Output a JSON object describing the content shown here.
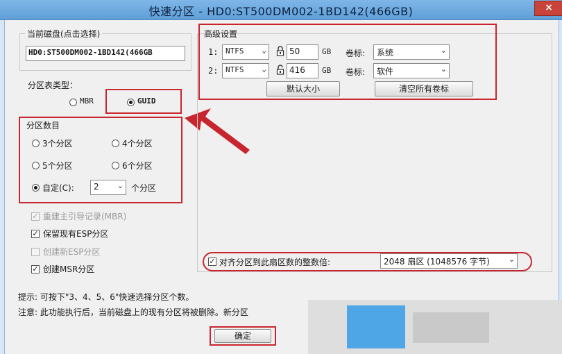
{
  "window": {
    "title": "快速分区 - HD0:ST500DM002-1BD142(466GB)",
    "close_label": "×"
  },
  "disk": {
    "section_label": "当前磁盘(点击选择)",
    "value": "HD0:ST500DM002-1BD142(466GB"
  },
  "partition_table": {
    "label": "分区表类型：",
    "options": [
      "MBR",
      "GUID"
    ],
    "selected": "GUID"
  },
  "partition_count": {
    "label": "分区数目",
    "options": [
      "3个分区",
      "4个分区",
      "5个分区",
      "6个分区"
    ],
    "custom_label": "自定(C):",
    "custom_value": "2",
    "custom_suffix": "个分区",
    "selected": "自定(C):"
  },
  "options": {
    "rebuild_mbr": "重建主引导记录(MBR)",
    "keep_esp": "保留现有ESP分区",
    "create_esp": "创建新ESP分区",
    "create_msr": "创建MSR分区"
  },
  "advanced": {
    "label": "高级设置",
    "rows": [
      {
        "index": "1:",
        "fs": "NTFS",
        "size": "50",
        "unit": "GB",
        "vol_label_caption": "卷标:",
        "vol_label": "系统"
      },
      {
        "index": "2:",
        "fs": "NTFS",
        "size": "416",
        "unit": "GB",
        "vol_label_caption": "卷标:",
        "vol_label": "软件"
      }
    ],
    "default_size_button": "默认大小",
    "clear_labels_button": "清空所有卷标"
  },
  "align": {
    "label": "对齐分区到此扇区数的整数倍:",
    "value": "2048 扇区 (1048576 字节)"
  },
  "hints": {
    "tip": "提示: 可按下\"3、4、5、6\"快速选择分区个数。",
    "note": "注意: 此功能执行后，当前磁盘上的现有分区将被删除。新分区"
  },
  "buttons": {
    "ok": "确定"
  },
  "icons": {
    "lock_closed": "lock-icon",
    "lock_open": "unlock-icon"
  },
  "colors": {
    "highlight": "#c8262e",
    "titlebar": "#6aa8df"
  }
}
